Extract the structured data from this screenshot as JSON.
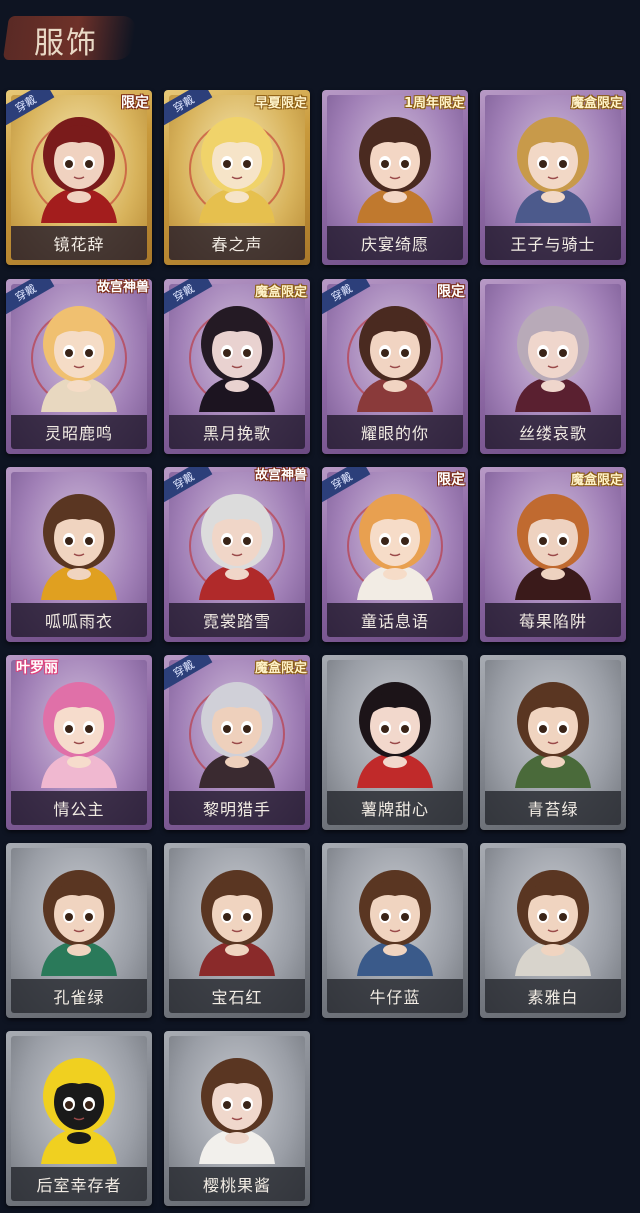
{
  "header": {
    "title": "服饰"
  },
  "wear_label": "穿戴",
  "costumes": [
    {
      "name": "镜花辞",
      "rarity": "gold",
      "tag": "限定",
      "tag_style": "",
      "worn": true,
      "hair": "#7a1b1b",
      "skin": "#f0d2c0",
      "outfit": "#a31d1d"
    },
    {
      "name": "春之声",
      "rarity": "gold",
      "tag": "早夏限定",
      "tag_style": "gold-tag",
      "worn": true,
      "hair": "#f0d36a",
      "skin": "#f6e4c8",
      "outfit": "#e6c04e"
    },
    {
      "name": "庆宴绮愿",
      "rarity": "purple",
      "tag": "1周年限定",
      "tag_style": "gold-tag",
      "worn": false,
      "hair": "#4a2a20",
      "skin": "#f3d6c4",
      "outfit": "#c0792e"
    },
    {
      "name": "王子与骑士",
      "rarity": "purple",
      "tag": "魔盒限定",
      "tag_style": "gold-tag",
      "worn": false,
      "hair": "#c89a4a",
      "skin": "#f2d8c6",
      "outfit": "#4c5a8c"
    },
    {
      "name": "灵昭鹿鸣",
      "rarity": "purple",
      "tag": "故宫神兽",
      "tag_style": "multi",
      "worn": true,
      "hair": "#f0c070",
      "skin": "#f5dcc6",
      "outfit": "#e8d8c0"
    },
    {
      "name": "黑月挽歌",
      "rarity": "purple",
      "tag": "魔盒限定",
      "tag_style": "gold-tag",
      "worn": true,
      "hair": "#241a24",
      "skin": "#e9d2d0",
      "outfit": "#1c1420"
    },
    {
      "name": "耀眼的你",
      "rarity": "purple",
      "tag": "限定",
      "tag_style": "",
      "worn": true,
      "hair": "#4a2a20",
      "skin": "#f1d4c2",
      "outfit": "#8a3a3a"
    },
    {
      "name": "丝缕哀歌",
      "rarity": "purple",
      "tag": "",
      "tag_style": "",
      "worn": false,
      "hair": "#b8aab8",
      "skin": "#efd6cc",
      "outfit": "#5a2030"
    },
    {
      "name": "呱呱雨衣",
      "rarity": "purple",
      "tag": "",
      "tag_style": "",
      "worn": false,
      "hair": "#5a3622",
      "skin": "#f0d4c0",
      "outfit": "#e0a020"
    },
    {
      "name": "霓裳踏雪",
      "rarity": "purple",
      "tag": "故宫神兽",
      "tag_style": "multi",
      "worn": true,
      "hair": "#dcdcdc",
      "skin": "#f0d6c8",
      "outfit": "#b02a2a"
    },
    {
      "name": "童话息语",
      "rarity": "purple",
      "tag": "限定",
      "tag_style": "",
      "worn": true,
      "hair": "#e8a050",
      "skin": "#f6dcc8",
      "outfit": "#f2ece4"
    },
    {
      "name": "莓果陷阱",
      "rarity": "purple",
      "tag": "魔盒限定",
      "tag_style": "gold-tag",
      "worn": false,
      "hair": "#c06a30",
      "skin": "#eed2c0",
      "outfit": "#3a1a1a"
    },
    {
      "name": "情公主",
      "rarity": "purple",
      "tag": "叶罗丽",
      "tag_style": "pink-tag",
      "worn": false,
      "hair": "#e070a8",
      "skin": "#f6dccc",
      "outfit": "#f0b8d0"
    },
    {
      "name": "黎明猎手",
      "rarity": "purple",
      "tag": "魔盒限定",
      "tag_style": "gold-tag",
      "worn": true,
      "hair": "#d0d0d8",
      "skin": "#eed0bc",
      "outfit": "#3a2a30"
    },
    {
      "name": "薯牌甜心",
      "rarity": "gray",
      "tag": "",
      "tag_style": "",
      "worn": false,
      "hair": "#1c1418",
      "skin": "#f2d8cc",
      "outfit": "#c02a2a"
    },
    {
      "name": "青苔绿",
      "rarity": "gray",
      "tag": "",
      "tag_style": "",
      "worn": false,
      "hair": "#5a3622",
      "skin": "#f0d4c0",
      "outfit": "#4a6a3a"
    },
    {
      "name": "孔雀绿",
      "rarity": "gray",
      "tag": "",
      "tag_style": "",
      "worn": false,
      "hair": "#5a3622",
      "skin": "#f0d4c0",
      "outfit": "#2a7a5a"
    },
    {
      "name": "宝石红",
      "rarity": "gray",
      "tag": "",
      "tag_style": "",
      "worn": false,
      "hair": "#5a3622",
      "skin": "#f0d4c0",
      "outfit": "#8a2a2a"
    },
    {
      "name": "牛仔蓝",
      "rarity": "gray",
      "tag": "",
      "tag_style": "",
      "worn": false,
      "hair": "#5a3622",
      "skin": "#f0d4c0",
      "outfit": "#3a5a8a"
    },
    {
      "name": "素雅白",
      "rarity": "gray",
      "tag": "",
      "tag_style": "",
      "worn": false,
      "hair": "#5a3622",
      "skin": "#f0d4c0",
      "outfit": "#d8d4cc"
    },
    {
      "name": "后室幸存者",
      "rarity": "gray",
      "tag": "",
      "tag_style": "",
      "worn": false,
      "hair": "#f0d020",
      "skin": "#1a1a1a",
      "outfit": "#f0d020"
    },
    {
      "name": "樱桃果酱",
      "rarity": "gray",
      "tag": "",
      "tag_style": "",
      "worn": false,
      "hair": "#5a3622",
      "skin": "#f0d8cc",
      "outfit": "#f2f0ec"
    }
  ]
}
